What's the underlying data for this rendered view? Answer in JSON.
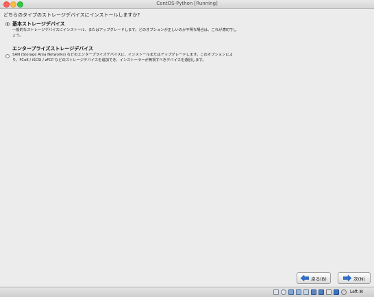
{
  "window": {
    "title": "CentOS-Python [Running]"
  },
  "installer": {
    "question": "どちらのタイプのストレージデバイスにインストールしますか?",
    "options": [
      {
        "title": "基本ストレージデバイス",
        "description": "一般的なストレージデバイスにインストール、またはアップグレードします。どのオプションが正しいのか不明な場合は、これが適切でしょう。",
        "selected": true
      },
      {
        "title": "エンタープライズストレージデバイス",
        "description": "SAN (Storage Area Networks) などのエンタープライズデバイスに、インストールまたはアップグレードします。このオプションにより、FCoE / iSCSI / zFCP などのストレージデバイスを追加でき、インストーラーが無視すべきデバイスを選別します。",
        "selected": false
      }
    ],
    "back_label": "戻る(B)",
    "next_label": "次(N)"
  },
  "statusbar": {
    "host_key": "Left ⌘",
    "icons": [
      "hard-disk-icon",
      "optical-drive-icon",
      "audio-icon",
      "network-icon",
      "usb-icon",
      "shared-folder-icon",
      "display-icon",
      "video-capture-icon",
      "cpu-icon",
      "mouse-integration-icon",
      "keyboard-icon"
    ]
  },
  "colors": {
    "accent": "#2e6fd1",
    "close": "#fc605c",
    "minimize": "#fdbc40",
    "maximize": "#34c84a"
  }
}
